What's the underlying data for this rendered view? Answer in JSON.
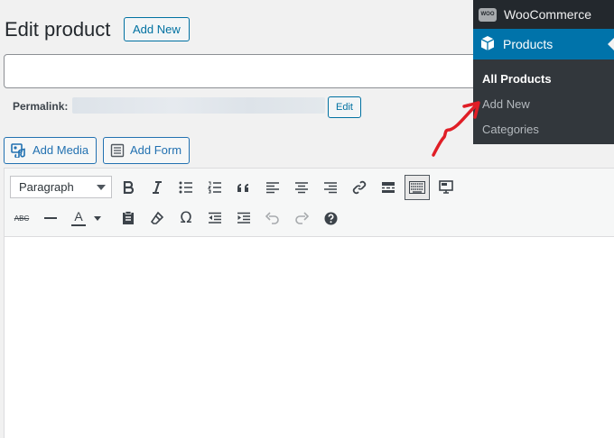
{
  "header": {
    "title": "Edit product",
    "add_new_label": "Add New"
  },
  "title_field": {
    "value": "",
    "placeholder": ""
  },
  "permalink": {
    "label": "Permalink:",
    "edit_label": "Edit"
  },
  "media_buttons": {
    "add_media": "Add Media",
    "add_form": "Add Form"
  },
  "editor": {
    "format_select": "Paragraph",
    "toolbar_row1": [
      "bold",
      "italic",
      "bulleted-list",
      "numbered-list",
      "blockquote",
      "align-left",
      "align-center",
      "align-right",
      "insert-link",
      "read-more",
      "toolbar-toggle",
      "distraction-free"
    ],
    "toolbar_row2": [
      "strikethrough",
      "horizontal-line",
      "text-color",
      "paste-as-text",
      "clear-formatting",
      "special-character",
      "decrease-indent",
      "increase-indent",
      "undo",
      "redo",
      "keyboard-shortcuts"
    ],
    "icon_labels": {
      "strikethrough": "ABC",
      "text_color": "A",
      "special_char": "Ω"
    }
  },
  "admin_menu": {
    "woocommerce_label": "WooCommerce",
    "woo_logo_text": "WOO",
    "products_label": "Products",
    "submenu": [
      {
        "label": "All Products",
        "current": true
      },
      {
        "label": "Add New",
        "current": false
      },
      {
        "label": "Categories",
        "current": false
      }
    ]
  },
  "colors": {
    "admin_bg": "#23282d",
    "submenu_bg": "#32373c",
    "active_menu": "#0073aa",
    "button_blue": "#0071a1",
    "annotation_red": "#e01e26"
  }
}
